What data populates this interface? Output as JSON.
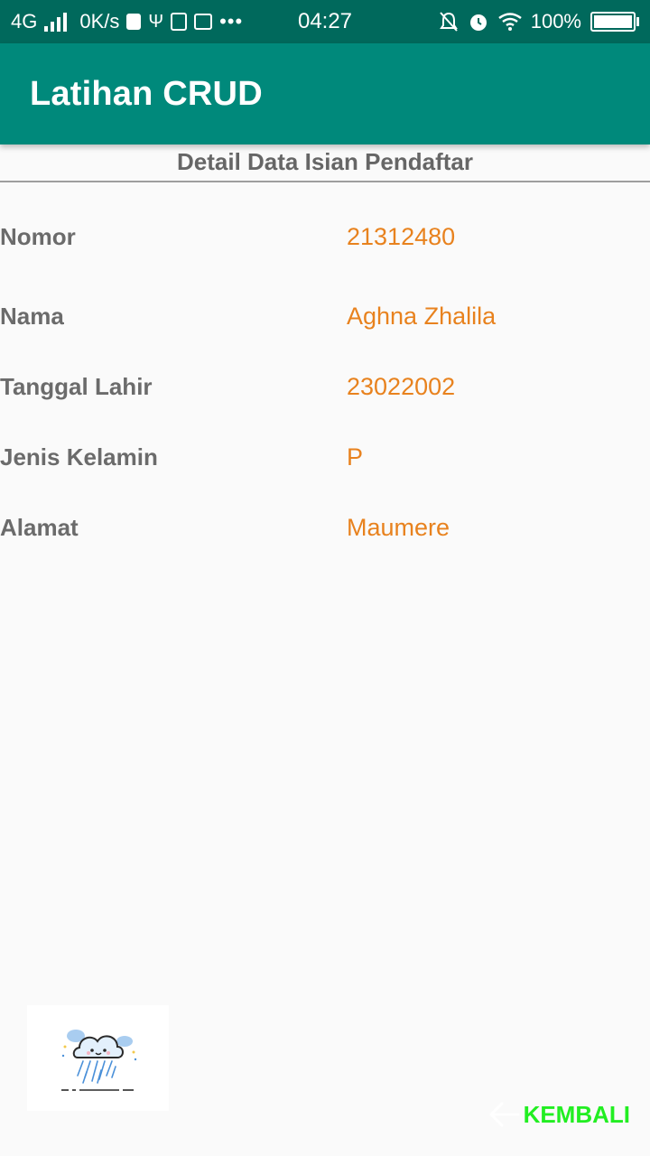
{
  "status_bar": {
    "network": "4G",
    "speed": "0K/s",
    "time": "04:27",
    "battery": "100%",
    "icons": [
      "signal-icon",
      "check-icon",
      "usb-icon",
      "app-icon",
      "mail-icon",
      "more-icon",
      "bell-muted-icon",
      "alarm-icon",
      "wifi-icon",
      "battery-icon"
    ]
  },
  "app_bar": {
    "title": "Latihan CRUD",
    "color": "#00897b"
  },
  "section": {
    "title": "Detail Data Isian Pendaftar"
  },
  "details": [
    {
      "label": "Nomor",
      "value": "21312480"
    },
    {
      "label": "Nama",
      "value": "Aghna Zhalila"
    },
    {
      "label": "Tanggal Lahir",
      "value": "23022002"
    },
    {
      "label": "Jenis Kelamin",
      "value": "P"
    },
    {
      "label": "Alamat",
      "value": "Maumere"
    }
  ],
  "footer": {
    "image_icon": "rain-cloud-icon",
    "back_icon": "arrow-left-icon",
    "back_label": "KEMBALI",
    "back_color": "#22ee22"
  },
  "colors": {
    "status_bar": "#00695c",
    "label": "#6b6b6b",
    "value": "#e8821e"
  }
}
